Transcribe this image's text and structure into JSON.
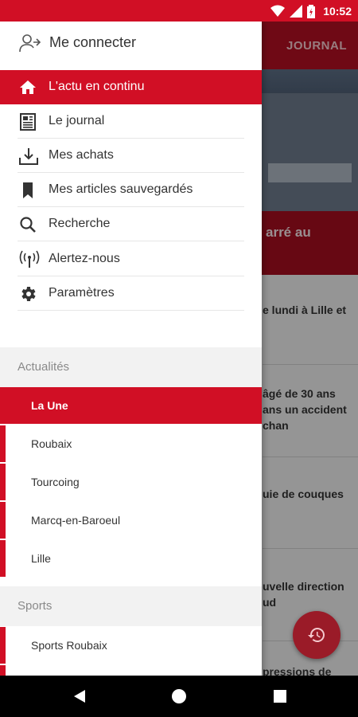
{
  "status_bar": {
    "time": "10:52"
  },
  "background": {
    "toolbar_label": "JOURNAL",
    "hero_caption": "arré au",
    "list": [
      "e lundi à Lille et",
      "âgé de 30 ans",
      "ans un accident",
      "chan",
      "uie de couques",
      "uvelle direction",
      "ud",
      "pressions de"
    ]
  },
  "drawer": {
    "login_label": "Me connecter",
    "menu": [
      {
        "label": "L'actu en continu",
        "icon": "home-icon",
        "active": true
      },
      {
        "label": "Le journal",
        "icon": "newspaper-icon"
      },
      {
        "label": "Mes achats",
        "icon": "download-icon"
      },
      {
        "label": "Mes articles sauvegardés",
        "icon": "bookmark-icon"
      },
      {
        "label": "Recherche",
        "icon": "search-icon"
      },
      {
        "label": "Alertez-nous",
        "icon": "broadcast-icon"
      },
      {
        "label": "Paramètres",
        "icon": "gear-icon"
      }
    ],
    "sections": [
      {
        "title": "Actualités",
        "items": [
          "La Une",
          "Roubaix",
          "Tourcoing",
          "Marcq-en-Baroeul",
          "Lille"
        ]
      },
      {
        "title": "Sports",
        "items": [
          "Sports Roubaix"
        ]
      }
    ]
  },
  "colors": {
    "accent": "#d10f25",
    "nav_bar": "#000000",
    "section_bg": "#f2f2f2"
  }
}
